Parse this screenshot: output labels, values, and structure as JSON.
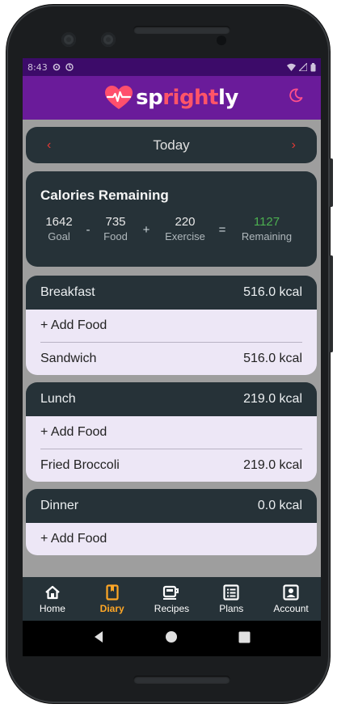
{
  "status_bar": {
    "time": "8:43"
  },
  "app": {
    "logo_prefix": "sp",
    "logo_accent": "right",
    "logo_suffix": "ly"
  },
  "date_nav": {
    "prev": "‹",
    "label": "Today",
    "next": "›"
  },
  "summary": {
    "title": "Calories Remaining",
    "goal": {
      "value": "1642",
      "label": "Goal"
    },
    "food": {
      "value": "735",
      "label": "Food"
    },
    "exercise": {
      "value": "220",
      "label": "Exercise"
    },
    "remaining": {
      "value": "1127",
      "label": "Remaining"
    },
    "ops": {
      "minus": "-",
      "plus": "+",
      "equals": "="
    }
  },
  "meals": [
    {
      "name": "Breakfast",
      "kcal": "516.0 kcal",
      "add_label": "+ Add Food",
      "items": [
        {
          "name": "Sandwich",
          "kcal": "516.0 kcal"
        }
      ]
    },
    {
      "name": "Lunch",
      "kcal": "219.0 kcal",
      "add_label": "+ Add Food",
      "items": [
        {
          "name": "Fried Broccoli",
          "kcal": "219.0 kcal"
        }
      ]
    },
    {
      "name": "Dinner",
      "kcal": "0.0 kcal",
      "add_label": "+ Add Food",
      "items": []
    }
  ],
  "bottom_nav": [
    {
      "label": "Home",
      "icon": "home-icon"
    },
    {
      "label": "Diary",
      "icon": "diary-icon",
      "active": true
    },
    {
      "label": "Recipes",
      "icon": "recipes-icon"
    },
    {
      "label": "Plans",
      "icon": "plans-icon"
    },
    {
      "label": "Account",
      "icon": "account-icon"
    }
  ],
  "colors": {
    "brand_purple": "#6a1b9a",
    "accent_red": "#ff5468",
    "card_dark": "#263238",
    "meal_body": "#ede7f6",
    "remaining_green": "#4caf50",
    "nav_active": "#ffa726"
  }
}
